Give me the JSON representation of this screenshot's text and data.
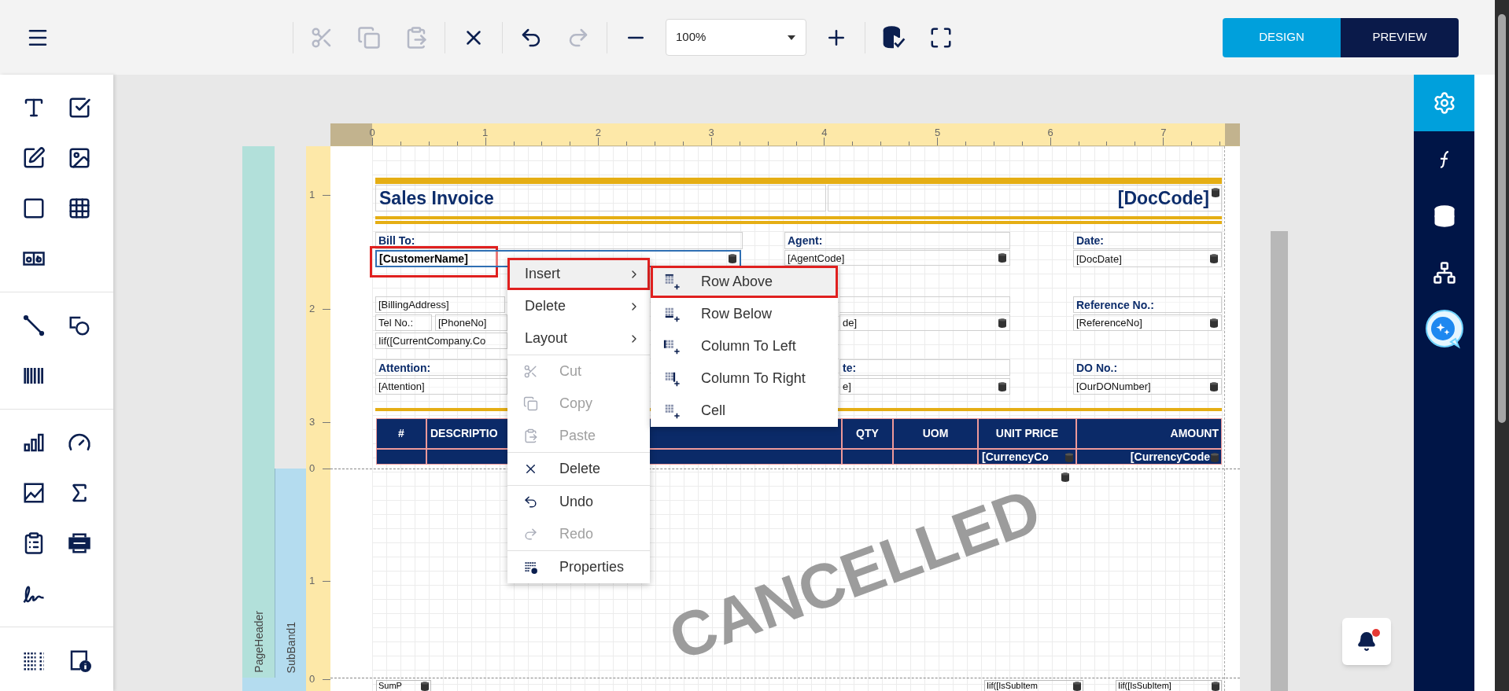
{
  "toolbar": {
    "groups": [
      [
        {
          "kind": "cut",
          "disabled": true
        },
        {
          "kind": "copy",
          "disabled": true
        },
        {
          "kind": "paste",
          "disabled": true
        }
      ],
      [
        {
          "kind": "delete",
          "disabled": false
        }
      ],
      [
        {
          "kind": "undo",
          "disabled": false
        },
        {
          "kind": "redo",
          "disabled": true
        }
      ],
      [
        {
          "kind": "zoom-out",
          "disabled": false
        },
        {
          "kind": "zoom-select",
          "value": "100%"
        },
        {
          "kind": "zoom-in",
          "disabled": false
        }
      ],
      [
        {
          "kind": "validate",
          "disabled": false
        },
        {
          "kind": "fullscreen",
          "disabled": false
        }
      ]
    ]
  },
  "mode_tabs": [
    {
      "label": "DESIGN",
      "selected": true
    },
    {
      "label": "PREVIEW",
      "selected": false
    }
  ],
  "toolbox": [
    [
      {
        "kind": "text"
      },
      {
        "kind": "checkbox"
      },
      {
        "kind": "edit"
      },
      {
        "kind": "image"
      },
      {
        "kind": "rectangle"
      },
      {
        "kind": "table"
      },
      {
        "kind": "label"
      }
    ],
    [
      {
        "kind": "line"
      },
      {
        "kind": "shapes"
      },
      {
        "kind": "barcode"
      }
    ],
    [
      {
        "kind": "bar-chart"
      },
      {
        "kind": "gauge"
      },
      {
        "kind": "line-chart"
      },
      {
        "kind": "summary"
      },
      {
        "kind": "clipboard"
      },
      {
        "kind": "pdf"
      },
      {
        "kind": "signature"
      }
    ],
    [
      {
        "kind": "list"
      },
      {
        "kind": "page-info"
      }
    ]
  ],
  "side_rail": [
    {
      "kind": "settings",
      "selected": true
    },
    {
      "kind": "function",
      "selected": false
    },
    {
      "kind": "data",
      "selected": false
    },
    {
      "kind": "structure",
      "selected": false
    },
    {
      "kind": "assistant",
      "selected": false
    }
  ],
  "rulers": {
    "horizontal": [
      "0",
      "1",
      "2",
      "3",
      "4",
      "5",
      "6",
      "7"
    ],
    "vertical": [
      "1",
      "2",
      "3",
      "0",
      "1",
      "0"
    ]
  },
  "bands": [
    "PageHeader",
    "SubBand1"
  ],
  "report": {
    "title": "Sales Invoice",
    "doc_code": "[DocCode]",
    "fields": [
      {
        "kind": "label",
        "text": "Bill To:",
        "bound": false,
        "selected": false,
        "highlighted": false
      },
      {
        "kind": "value",
        "text": "[CustomerName]",
        "bound": true,
        "selected": true,
        "highlighted": true
      },
      {
        "kind": "value",
        "text": "[BillingAddress]",
        "bound": false,
        "selected": false,
        "highlighted": false
      },
      {
        "kind": "value",
        "text": "Tel No.:",
        "bound": false,
        "selected": false,
        "highlighted": false
      },
      {
        "kind": "value",
        "text": "[PhoneNo]",
        "bound": false,
        "selected": false,
        "highlighted": false
      },
      {
        "kind": "value",
        "text": "Iif([CurrentCompany.Co",
        "bound": false,
        "selected": false,
        "highlighted": false
      },
      {
        "kind": "label",
        "text": "Attention:",
        "bound": false,
        "selected": false,
        "highlighted": false
      },
      {
        "kind": "value",
        "text": "[Attention]",
        "bound": false,
        "selected": false,
        "highlighted": false
      },
      {
        "kind": "label",
        "text": "Agent:",
        "bound": false,
        "selected": false,
        "highlighted": false
      },
      {
        "kind": "value",
        "text": "[AgentCode]",
        "bound": true,
        "selected": false,
        "highlighted": false
      },
      {
        "kind": "value",
        "text": "de]",
        "bound": true,
        "selected": false,
        "highlighted": false
      },
      {
        "kind": "label",
        "text": "te:",
        "bound": false,
        "selected": false,
        "highlighted": false
      },
      {
        "kind": "value",
        "text": "e]",
        "bound": true,
        "selected": false,
        "highlighted": false
      },
      {
        "kind": "label",
        "text": "Date:",
        "bound": false,
        "selected": false,
        "highlighted": false
      },
      {
        "kind": "value",
        "text": "[DocDate]",
        "bound": true,
        "selected": false,
        "highlighted": false
      },
      {
        "kind": "label",
        "text": "Reference No.:",
        "bound": false,
        "selected": false,
        "highlighted": false
      },
      {
        "kind": "value",
        "text": "[ReferenceNo]",
        "bound": true,
        "selected": false,
        "highlighted": false
      },
      {
        "kind": "label",
        "text": "DO No.:",
        "bound": false,
        "selected": false,
        "highlighted": false
      },
      {
        "kind": "value",
        "text": "[OurDONumber]",
        "bound": true,
        "selected": false,
        "highlighted": false
      }
    ],
    "table": {
      "columns": [
        "#",
        "DESCRIPTIO",
        "QTY",
        "UOM",
        "UNIT PRICE",
        "AMOUNT"
      ],
      "currency_cells": [
        "[CurrencyCo",
        "[CurrencyCode"
      ]
    },
    "watermark": "CANCELLED",
    "detail_row": [
      "SumP",
      "Iif([IsSubItem",
      "Iif([IsSubItem]"
    ]
  },
  "context_menu": {
    "groups": [
      [
        {
          "label": "Insert",
          "kind": "submenu",
          "selected": true,
          "highlighted": true,
          "disabled": false
        },
        {
          "label": "Delete",
          "kind": "submenu",
          "selected": false,
          "highlighted": false,
          "disabled": false
        },
        {
          "label": "Layout",
          "kind": "submenu",
          "selected": false,
          "highlighted": false,
          "disabled": false
        }
      ],
      [
        {
          "label": "Cut",
          "kind": "cut",
          "selected": false,
          "highlighted": false,
          "disabled": true
        },
        {
          "label": "Copy",
          "kind": "copy",
          "selected": false,
          "highlighted": false,
          "disabled": true
        },
        {
          "label": "Paste",
          "kind": "paste",
          "selected": false,
          "highlighted": false,
          "disabled": true
        }
      ],
      [
        {
          "label": "Delete",
          "kind": "delete",
          "selected": false,
          "highlighted": false,
          "disabled": false
        }
      ],
      [
        {
          "label": "Undo",
          "kind": "undo",
          "selected": false,
          "highlighted": false,
          "disabled": false
        },
        {
          "label": "Redo",
          "kind": "redo",
          "selected": false,
          "highlighted": false,
          "disabled": true
        }
      ],
      [
        {
          "label": "Properties",
          "kind": "properties",
          "selected": false,
          "highlighted": false,
          "disabled": false
        }
      ]
    ],
    "submenu": [
      {
        "label": "Row Above",
        "kind": "row-above",
        "selected": true,
        "highlighted": true
      },
      {
        "label": "Row Below",
        "kind": "row-below",
        "selected": false,
        "highlighted": false
      },
      {
        "label": "Column To Left",
        "kind": "column-left",
        "selected": false,
        "highlighted": false
      },
      {
        "label": "Column To Right",
        "kind": "column-right",
        "selected": false,
        "highlighted": false
      },
      {
        "label": "Cell",
        "kind": "cell",
        "selected": false,
        "highlighted": false
      }
    ]
  },
  "notifications": {
    "unread": true
  }
}
